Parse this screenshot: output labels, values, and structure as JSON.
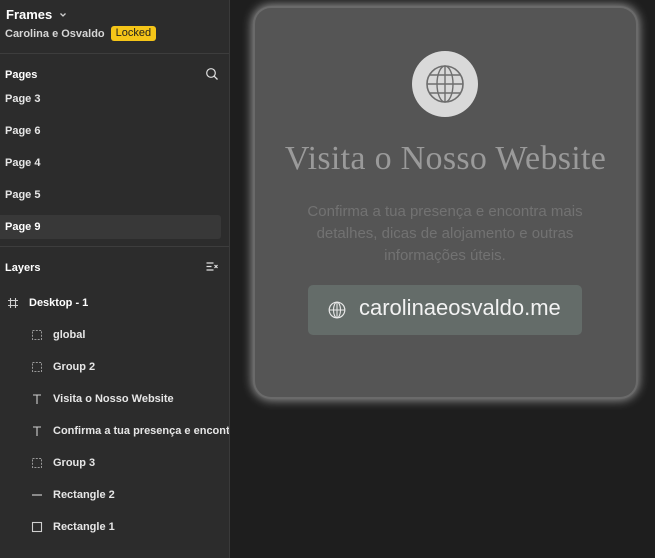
{
  "header": {
    "title": "Frames",
    "project": "Carolina e Osvaldo",
    "badge": "Locked"
  },
  "pages": {
    "heading": "Pages",
    "items": [
      {
        "label": "Page 3",
        "active": false
      },
      {
        "label": "Page 6",
        "active": false
      },
      {
        "label": "Page 4",
        "active": false
      },
      {
        "label": "Page 5",
        "active": false
      },
      {
        "label": "Page 9",
        "active": true
      }
    ]
  },
  "layers": {
    "heading": "Layers",
    "items": [
      {
        "label": "Desktop - 1",
        "icon": "frame-icon"
      },
      {
        "label": "global",
        "icon": "group-icon"
      },
      {
        "label": "Group 2",
        "icon": "group-icon"
      },
      {
        "label": "Visita o Nosso Website",
        "icon": "text-icon"
      },
      {
        "label": "Confirma a tua presença e encontra mais detalhes, dicas de alojamento e outras informações úteis.",
        "icon": "text-icon"
      },
      {
        "label": "Group 3",
        "icon": "group-icon"
      },
      {
        "label": "Rectangle 2",
        "icon": "line-icon"
      },
      {
        "label": "Rectangle 1",
        "icon": "rectangle-icon"
      }
    ]
  },
  "canvas": {
    "title": "Visita o Nosso Website",
    "body": "Confirma a tua presença e encontra mais detalhes, dicas de alojamento e outras informações úteis.",
    "link": "carolinaeosvaldo.me"
  },
  "colors": {
    "badge": "#f5c518",
    "sidebar": "#2c2c2c",
    "canvas": "#1e1e1e",
    "card": "#555555",
    "button": "#646c69"
  }
}
